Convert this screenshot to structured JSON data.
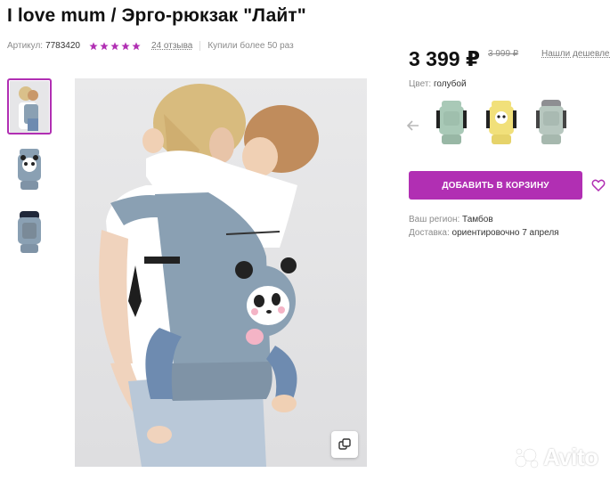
{
  "product": {
    "title": "I love mum / Эрго-рюкзак \"Лайт\"",
    "sku_label": "Артикул:",
    "sku_value": "7783420",
    "rating": 5,
    "reviews": "24 отзыва",
    "bought": "Купили более 50 раз"
  },
  "gallery": {
    "thumbnails": [
      "thumbnail-1",
      "thumbnail-2",
      "thumbnail-3"
    ],
    "active_index": 0
  },
  "pricing": {
    "price": "3 399 ₽",
    "old_price": "3 999 ₽",
    "cheaper_link": "Нашли дешевле?"
  },
  "color": {
    "label": "Цвет:",
    "value": "голубой",
    "options": [
      "mint",
      "yellow",
      "sage"
    ]
  },
  "actions": {
    "add_to_cart": "ДОБАВИТЬ В КОРЗИНУ"
  },
  "delivery": {
    "region_label": "Ваш регион:",
    "region_value": "Тамбов",
    "delivery_label": "Доставка:",
    "delivery_value": "ориентировочно 7 апреля"
  },
  "watermark": {
    "text": "Avito"
  },
  "icons": {
    "star": "star-icon",
    "zoom": "expand-icon",
    "prev": "arrow-left-icon",
    "favorite": "heart-icon"
  },
  "colors": {
    "accent": "#b12fb3",
    "star": "#b12fb3",
    "carrier_blue": "#8aa0b3",
    "carrier_mint": "#a9c9b7",
    "carrier_yellow": "#f1e07a",
    "carrier_sage": "#b7c7bf"
  }
}
